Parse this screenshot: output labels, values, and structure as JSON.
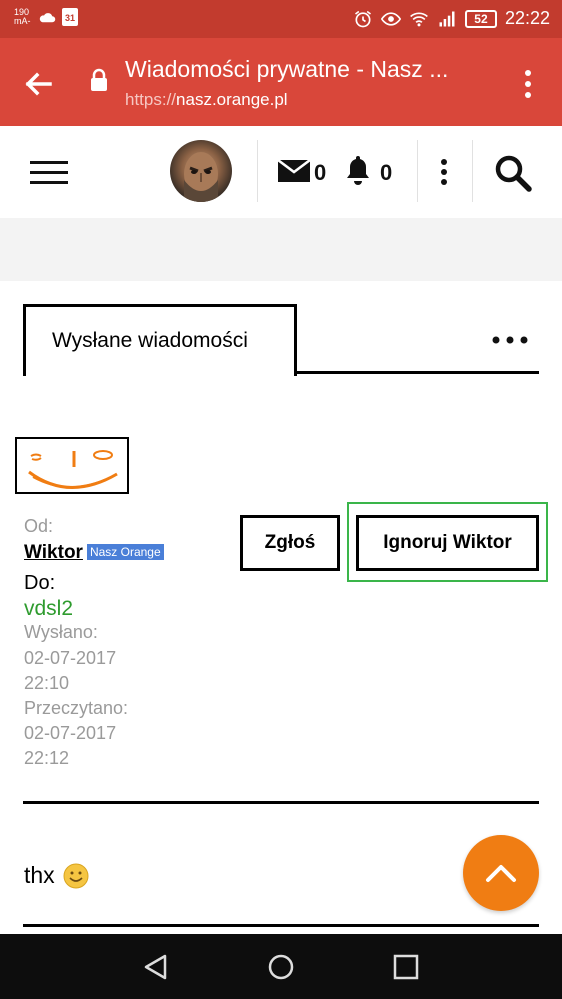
{
  "status_bar": {
    "net_speed_value": "190",
    "net_speed_unit": "mA-",
    "calendar_day": "31",
    "battery": "52",
    "time": "22:22"
  },
  "browser": {
    "title": "Wiadomości prywatne - Nasz ...",
    "url_scheme": "https://",
    "url_host": "nasz.orange.pl"
  },
  "header": {
    "mail_count": "0",
    "notification_count": "0"
  },
  "tabs": {
    "active_label": "Wysłane wiadomości"
  },
  "message": {
    "from_label": "Od:",
    "from_name": "Wiktor",
    "from_badge": "Nasz Orange",
    "to_label": "Do:",
    "to_name": "vdsl2",
    "sent_label": "Wysłano:",
    "sent_date": "02-07-2017",
    "sent_time": "22:10",
    "read_label": "Przeczytano:",
    "read_date": "02-07-2017",
    "read_time": "22:12",
    "body": "thx"
  },
  "actions": {
    "report_label": "Zgłoś",
    "ignore_label": "Ignoruj Wiktor"
  },
  "colors": {
    "status_bar": "#c23b2e",
    "browser_bar": "#d9473a",
    "accent_fab": "#f07d13",
    "recipient_green": "#2e9b2e",
    "highlight_green": "#3ab54a"
  }
}
